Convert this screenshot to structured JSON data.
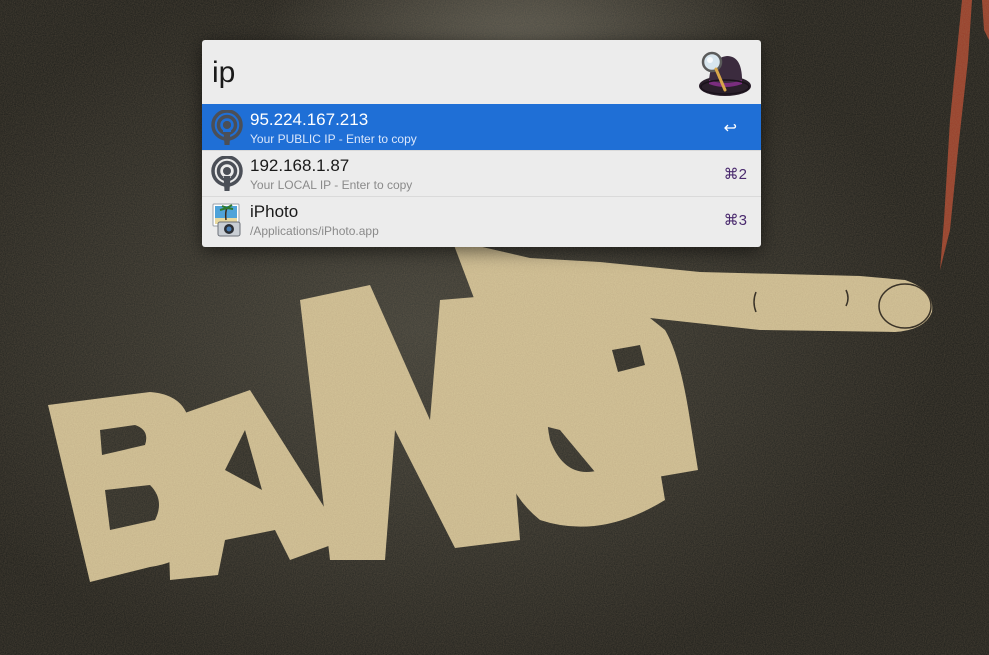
{
  "wallpaper": {
    "text": "BANG"
  },
  "alfred": {
    "query": "ip",
    "logo_icon": "alfred-hat-icon",
    "results": [
      {
        "title": "95.224.167.213",
        "subtitle": "Your PUBLIC IP - Enter to copy",
        "shortcut": "↩",
        "icon": "podcast-broadcast-icon",
        "selected": true
      },
      {
        "title": "192.168.1.87",
        "subtitle": "Your LOCAL IP - Enter to copy",
        "shortcut": "⌘2",
        "icon": "podcast-broadcast-icon",
        "selected": false
      },
      {
        "title": "iPhoto",
        "subtitle": "/Applications/iPhoto.app",
        "shortcut": "⌘3",
        "icon": "iphoto-app-icon",
        "selected": false
      }
    ]
  },
  "colors": {
    "selection": "#1f6fd6",
    "window_bg": "#ececec",
    "shortcut": "#4a2a6e",
    "wallpaper_letters": "#d6c69a"
  }
}
